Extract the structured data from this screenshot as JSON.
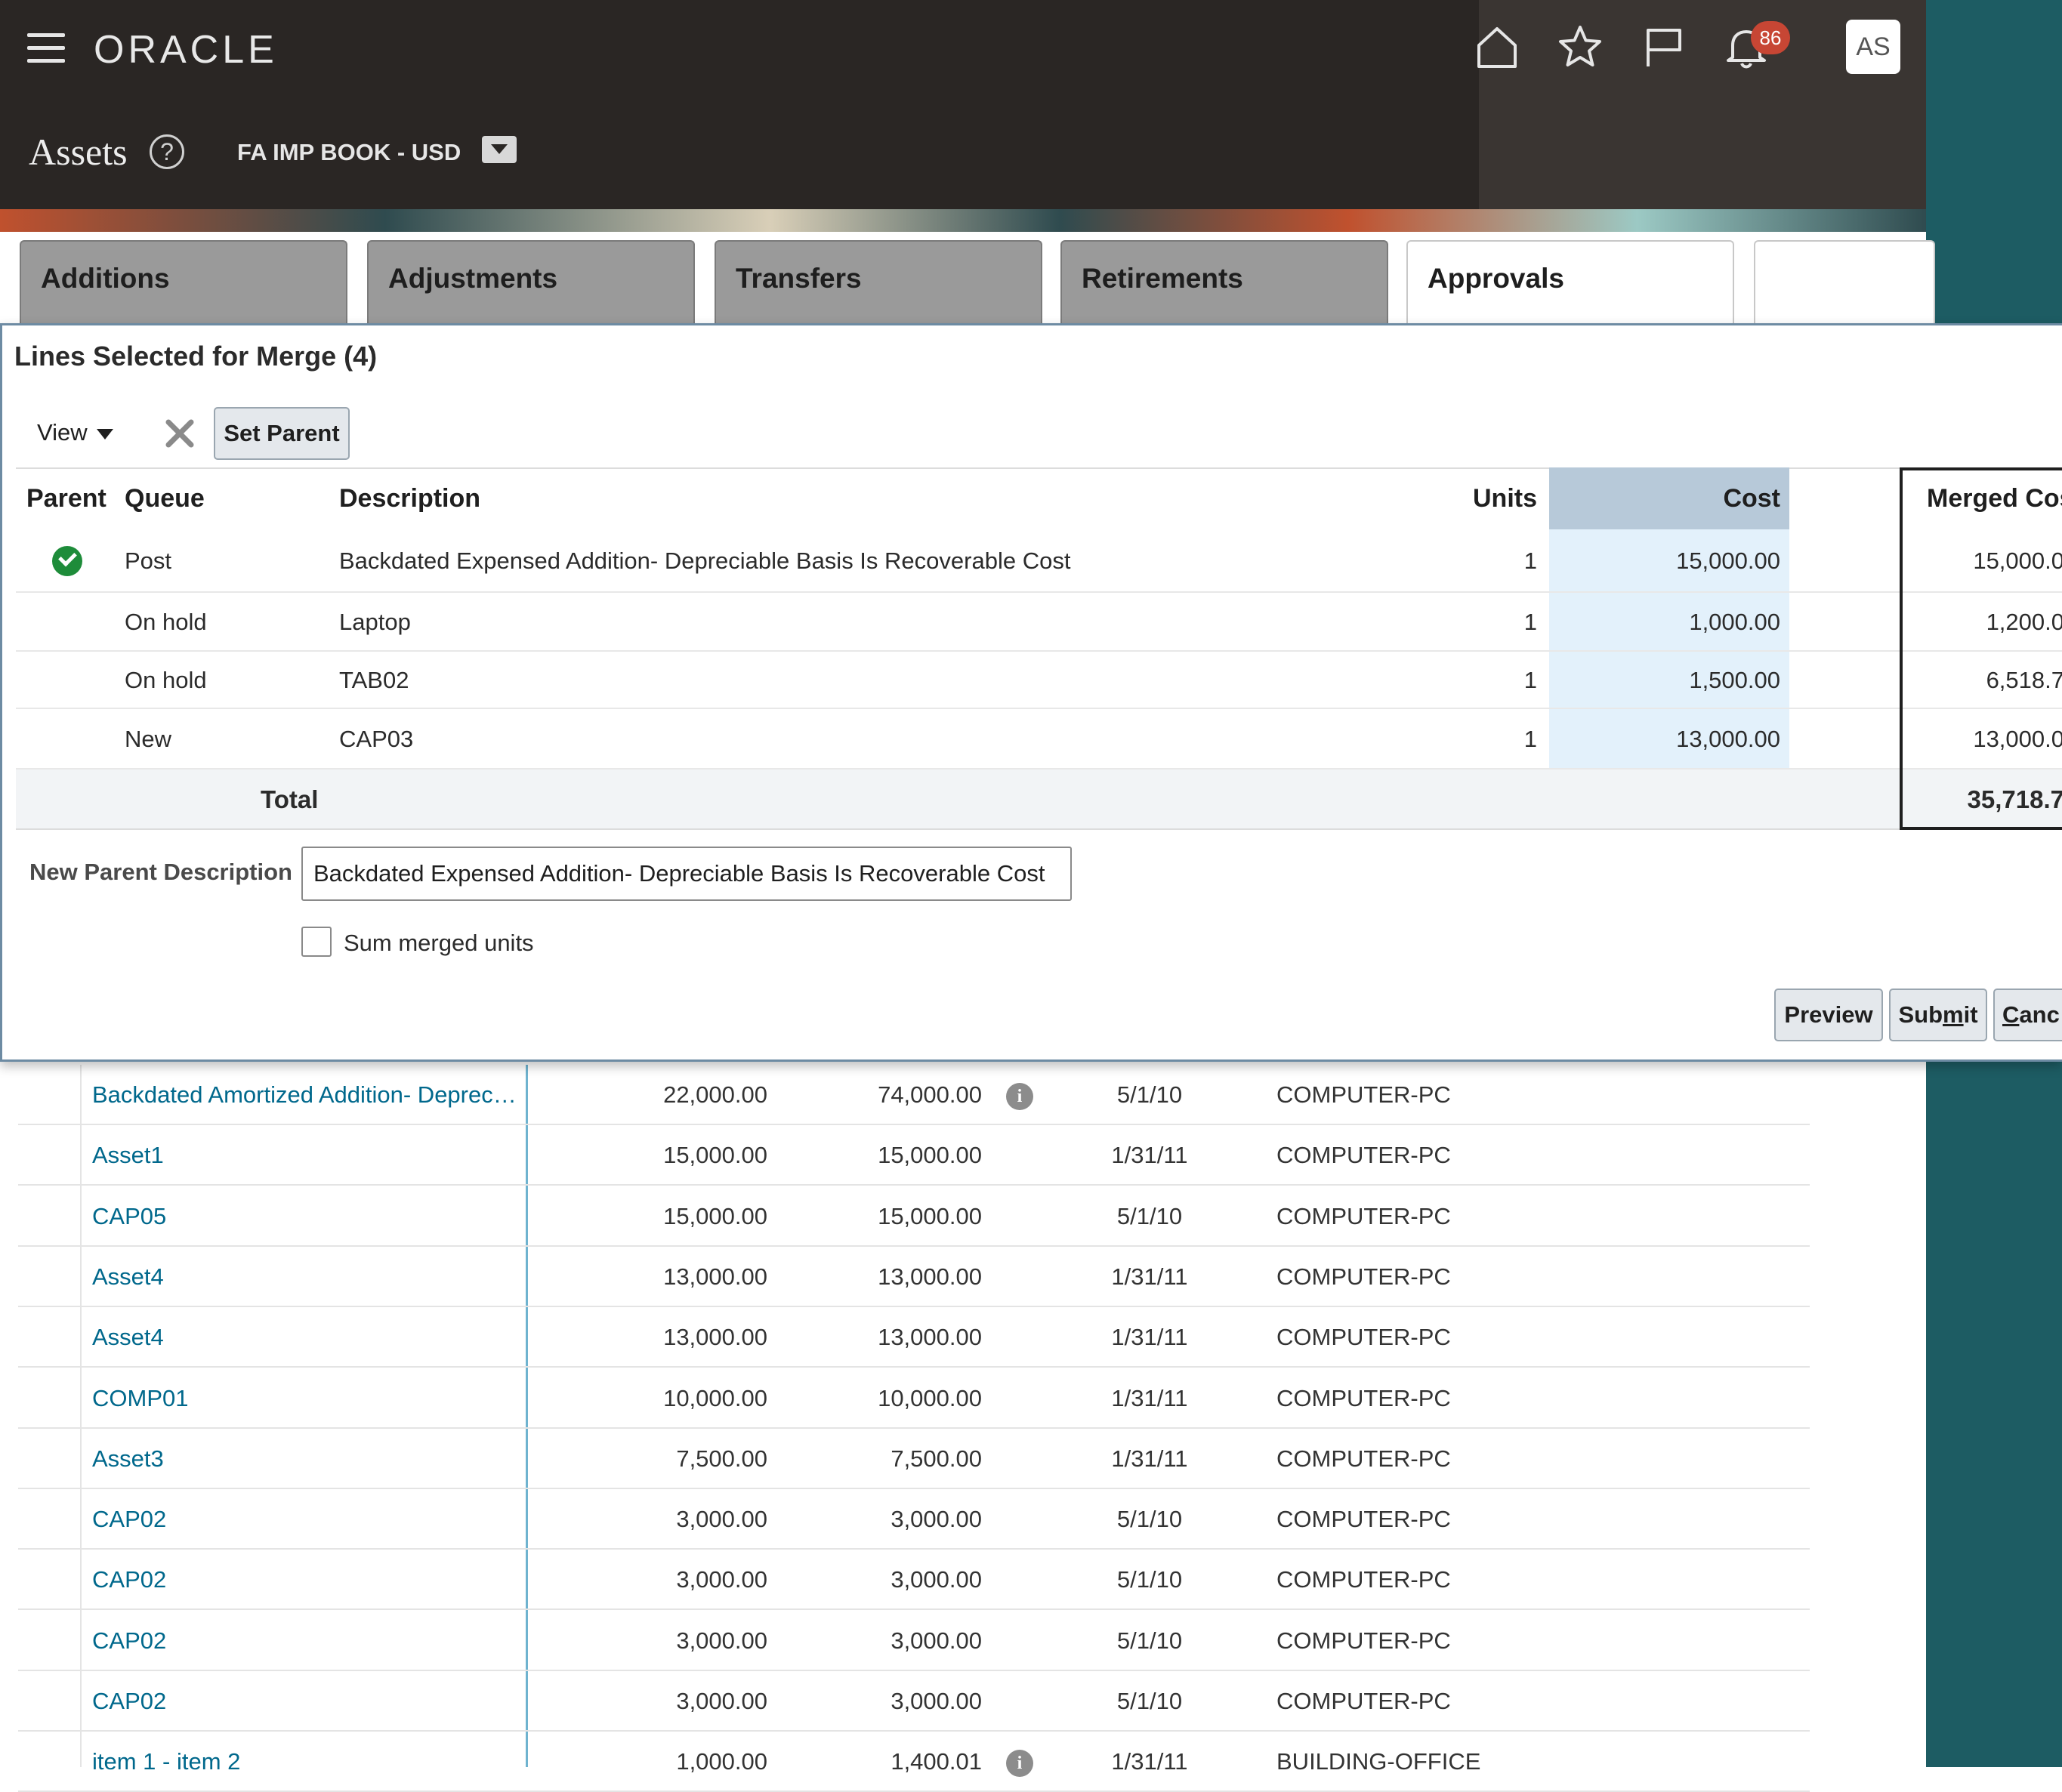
{
  "header": {
    "logo": "ORACLE",
    "notifications_count": "86",
    "user_initials": "AS",
    "page_title": "Assets",
    "book": "FA IMP BOOK - USD"
  },
  "tabs": [
    {
      "label": "Additions"
    },
    {
      "label": "Adjustments"
    },
    {
      "label": "Transfers"
    },
    {
      "label": "Retirements"
    },
    {
      "label": "Approvals"
    }
  ],
  "dialog": {
    "title": "Lines Selected for Merge (4)",
    "toolbar": {
      "view_label": "View",
      "set_parent_label": "Set Parent"
    },
    "columns": {
      "parent": "Parent",
      "queue": "Queue",
      "description": "Description",
      "units": "Units",
      "cost": "Cost",
      "merged_cost": "Merged Cos"
    },
    "rows": [
      {
        "parent": true,
        "queue": "Post",
        "description": "Backdated Expensed Addition- Depreciable Basis Is Recoverable Cost",
        "units": "1",
        "cost": "15,000.00",
        "merged_cost": "15,000.0"
      },
      {
        "parent": false,
        "queue": "On hold",
        "description": "Laptop",
        "units": "1",
        "cost": "1,000.00",
        "merged_cost": "1,200.0"
      },
      {
        "parent": false,
        "queue": "On hold",
        "description": "TAB02",
        "units": "1",
        "cost": "1,500.00",
        "merged_cost": "6,518.7"
      },
      {
        "parent": false,
        "queue": "New",
        "description": "CAP03",
        "units": "1",
        "cost": "13,000.00",
        "merged_cost": "13,000.0"
      }
    ],
    "total": {
      "label": "Total",
      "merged_cost": "35,718.7"
    },
    "new_parent_label": "New Parent Description",
    "new_parent_value": "Backdated Expensed Addition- Depreciable Basis Is Recoverable Cost",
    "sum_units_label": "Sum merged units",
    "buttons": {
      "preview": "Preview",
      "submit_pre": "Sub",
      "submit_mnemonic": "m",
      "submit_post": "it",
      "cancel_mnemonic": "C",
      "cancel_post": "anc"
    }
  },
  "background_rows": [
    {
      "name": "Backdated Amortized Addition- Deprec…",
      "cost": "22,000.00",
      "recoverable": "74,000.00",
      "info": true,
      "date": "5/1/10",
      "category": "COMPUTER-PC"
    },
    {
      "name": "Asset1",
      "cost": "15,000.00",
      "recoverable": "15,000.00",
      "info": false,
      "date": "1/31/11",
      "category": "COMPUTER-PC"
    },
    {
      "name": "CAP05",
      "cost": "15,000.00",
      "recoverable": "15,000.00",
      "info": false,
      "date": "5/1/10",
      "category": "COMPUTER-PC"
    },
    {
      "name": "Asset4",
      "cost": "13,000.00",
      "recoverable": "13,000.00",
      "info": false,
      "date": "1/31/11",
      "category": "COMPUTER-PC"
    },
    {
      "name": "Asset4",
      "cost": "13,000.00",
      "recoverable": "13,000.00",
      "info": false,
      "date": "1/31/11",
      "category": "COMPUTER-PC"
    },
    {
      "name": "COMP01",
      "cost": "10,000.00",
      "recoverable": "10,000.00",
      "info": false,
      "date": "1/31/11",
      "category": "COMPUTER-PC"
    },
    {
      "name": "Asset3",
      "cost": "7,500.00",
      "recoverable": "7,500.00",
      "info": false,
      "date": "1/31/11",
      "category": "COMPUTER-PC"
    },
    {
      "name": "CAP02",
      "cost": "3,000.00",
      "recoverable": "3,000.00",
      "info": false,
      "date": "5/1/10",
      "category": "COMPUTER-PC"
    },
    {
      "name": "CAP02",
      "cost": "3,000.00",
      "recoverable": "3,000.00",
      "info": false,
      "date": "5/1/10",
      "category": "COMPUTER-PC"
    },
    {
      "name": "CAP02",
      "cost": "3,000.00",
      "recoverable": "3,000.00",
      "info": false,
      "date": "5/1/10",
      "category": "COMPUTER-PC"
    },
    {
      "name": "CAP02",
      "cost": "3,000.00",
      "recoverable": "3,000.00",
      "info": false,
      "date": "5/1/10",
      "category": "COMPUTER-PC"
    },
    {
      "name": "item 1 - item 2",
      "cost": "1,000.00",
      "recoverable": "1,400.01",
      "info": true,
      "date": "1/31/11",
      "category": "BUILDING-OFFICE"
    }
  ]
}
